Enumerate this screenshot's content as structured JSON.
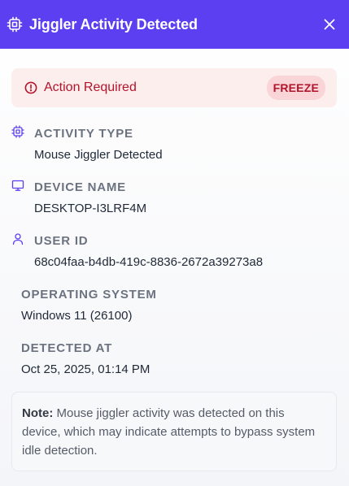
{
  "header": {
    "title": "Jiggler Activity Detected",
    "bg_color": "#5c3ff0"
  },
  "alert": {
    "text": "Action Required",
    "badge": "FREEZE",
    "color": "#b3142b"
  },
  "fields": {
    "activity_type": {
      "label": "ACTIVITY TYPE",
      "value": "Mouse Jiggler Detected",
      "icon": "cpu-chip-icon"
    },
    "device_name": {
      "label": "DEVICE NAME",
      "value": "DESKTOP-I3LRF4M",
      "icon": "monitor-icon"
    },
    "user_id": {
      "label": "USER ID",
      "value": "68c04faa-b4db-419c-8836-2672a39273a8",
      "icon": "user-icon"
    },
    "os": {
      "label": "OPERATING SYSTEM",
      "value": "Windows 11 (26100)"
    },
    "detected_at": {
      "label": "DETECTED AT",
      "value": "Oct 25, 2025, 01:14 PM"
    }
  },
  "note": {
    "prefix": "Note:",
    "text": " Mouse jiggler activity was detected on this device, which may indicate attempts to bypass system idle detection."
  }
}
